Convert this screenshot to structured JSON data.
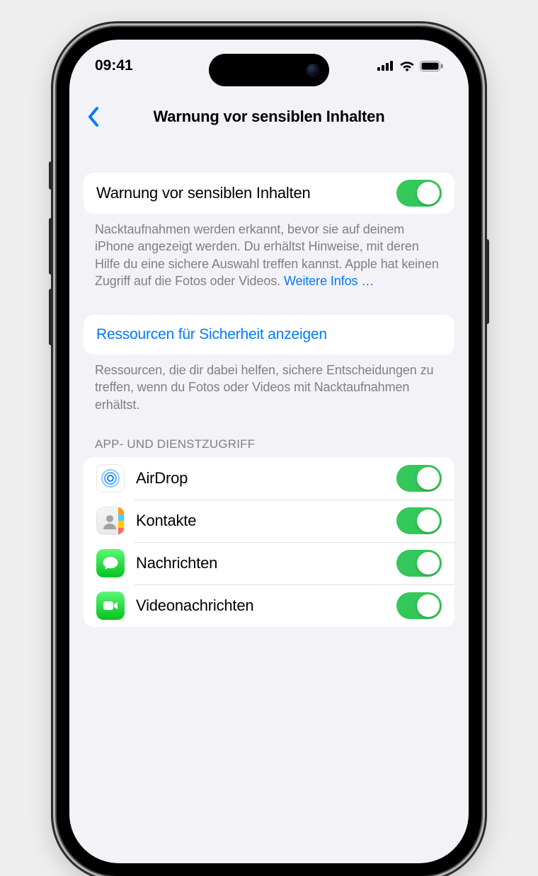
{
  "statusbar": {
    "time": "09:41"
  },
  "nav": {
    "title": "Warnung vor sensiblen Inhalten"
  },
  "main_switch": {
    "label": "Warnung vor sensiblen Inhalten",
    "on": true,
    "footer": "Nacktaufnahmen werden erkannt, bevor sie auf deinem iPhone angezeigt werden. Du erhältst Hinweise, mit deren Hilfe du eine sichere Auswahl treffen kannst. Apple hat keinen Zugriff auf die Fotos oder Videos. ",
    "footer_link": "Weitere Infos …"
  },
  "resources": {
    "label": "Ressourcen für Sicherheit anzeigen",
    "footer": "Ressourcen, die dir dabei helfen, sichere Entschei­dungen zu treffen, wenn du Fotos oder Videos mit Nacktaufnahmen erhältst."
  },
  "apps": {
    "header": "APP- UND DIENSTZUGRIFF",
    "items": [
      {
        "icon": "airdrop",
        "label": "AirDrop",
        "on": true
      },
      {
        "icon": "contacts",
        "label": "Kontakte",
        "on": true
      },
      {
        "icon": "messages",
        "label": "Nachrichten",
        "on": true
      },
      {
        "icon": "facetime",
        "label": "Videonachrichten",
        "on": true
      }
    ]
  }
}
